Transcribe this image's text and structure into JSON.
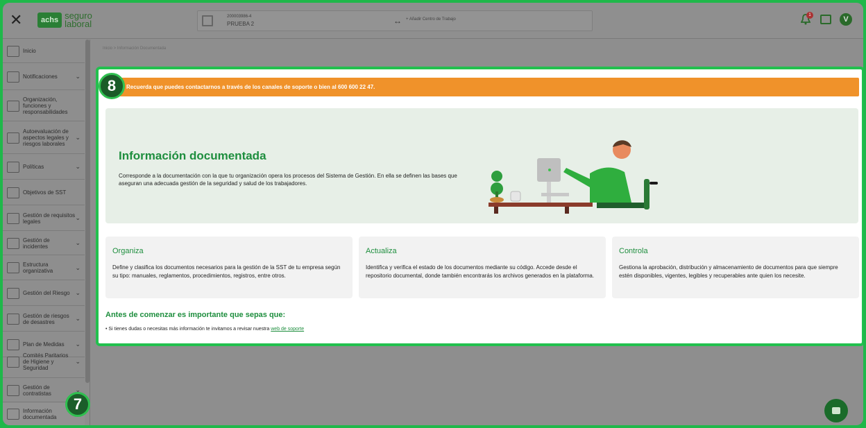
{
  "topbar": {
    "close_glyph": "✕",
    "logo_badge": "achs",
    "logo_line1": "seguro",
    "logo_line2": "laboral",
    "company_code": "200003986-4",
    "company_name": "PRUEBA 2",
    "swap_glyph": "↔",
    "add_worksite": "+  Añadir Centro de Trabajo",
    "notif_count": "1",
    "avatar_letter": "V"
  },
  "sidebar": {
    "items": [
      {
        "label": "Inicio",
        "chevron": ""
      },
      {
        "label": "Notificaciones",
        "chevron": "⌄"
      },
      {
        "label": "Organización, funciones y responsabilidades",
        "chevron": ""
      },
      {
        "label": "Autoevaluación de aspectos legales y riesgos laborales",
        "chevron": "⌄"
      },
      {
        "label": "Políticas",
        "chevron": "⌄"
      },
      {
        "label": "Objetivos de SST",
        "chevron": ""
      },
      {
        "label": "Gestión de requisitos legales",
        "chevron": "⌄"
      },
      {
        "label": "Gestión de incidentes",
        "chevron": "⌄"
      },
      {
        "label": "Estructura organizativa",
        "chevron": "⌄"
      },
      {
        "label": "Gestión del Riesgo",
        "chevron": "⌄"
      },
      {
        "label": "Gestión de riesgos de desastres",
        "chevron": "⌄"
      },
      {
        "label": "Plan de Medidas",
        "chevron": "⌄"
      },
      {
        "label": "Comités Paritarios de Higiene y Seguridad",
        "chevron": "⌄"
      },
      {
        "label": "Gestión de contratistas",
        "chevron": "⌄"
      },
      {
        "label": "Información documentada",
        "chevron": ""
      }
    ],
    "step_marker": "7"
  },
  "main": {
    "breadcrumb": "Inicio > Información Documentada",
    "step_marker": "8",
    "alert": "Recuerda que puedes contactarnos a través de los canales de soporte o bien al 600 600 22 47.",
    "hero_title": "Información documentada",
    "hero_desc": "Corresponde a la documentación con la que tu organización opera los procesos del Sistema de Gestión. En ella se definen las bases que aseguran una adecuada gestión de la seguridad y salud de los trabajadores.",
    "cards": [
      {
        "title": "Organiza",
        "text": "Define y clasifica los documentos necesarios para la gestión de la SST de tu empresa según su tipo: manuales, reglamentos, procedimientos, registros, entre otros."
      },
      {
        "title": "Actualiza",
        "text": "Identifica y verifica el estado de los documentos mediante su código. Accede desde el repositorio documental, donde también encontrarás los archivos generados en la plataforma."
      },
      {
        "title": "Controla",
        "text": "Gestiona la aprobación, distribución y almacenamiento de documentos para que siempre estén disponibles, vigentes, legibles y recuperables ante quien los necesite."
      }
    ],
    "before_title": "Antes de comenzar es importante que sepas que:",
    "tip_prefix": "•  Si tienes dudas o necesitas más información te invitamos a revisar nuestra",
    "tip_link": "web de soporte"
  },
  "colors": {
    "accent": "#1e8e3e",
    "alert": "#f0922a",
    "highlight": "#22c04e"
  }
}
